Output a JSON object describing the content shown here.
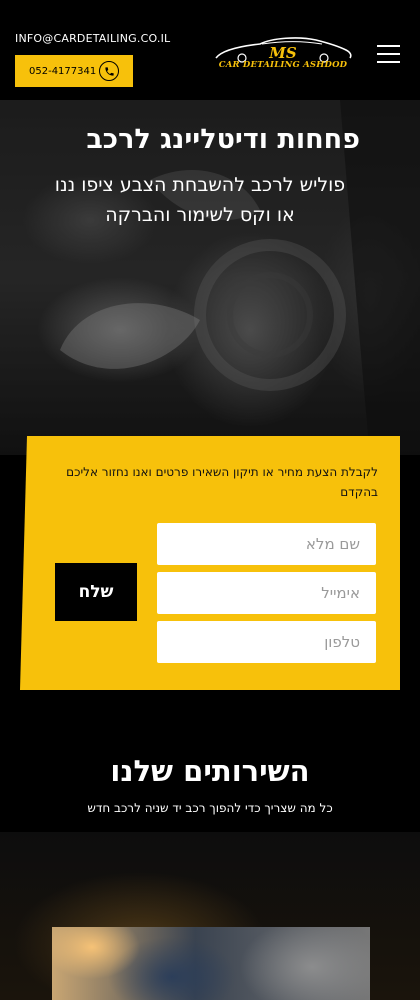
{
  "header": {
    "email": "INFO@CARDETAILING.CO.IL",
    "phone": "052-4177341",
    "logo_initials": "MS",
    "logo_name": "CAR DETAILING ASHDOD"
  },
  "hero": {
    "title": "פחחות ודיטליינג לרכב",
    "subtitle": "פוליש לרכב להשבחת הצבע ציפו ננו או וקס לשימור והברקה"
  },
  "form": {
    "note": "לקבלת הצעת מחיר או תיקון השאירו פרטים ואנו נחזור אליכם בהקדם",
    "name_placeholder": "שם מלא",
    "email_placeholder": "אימייל",
    "phone_placeholder": "טלפון",
    "submit_label": "שלח"
  },
  "services": {
    "title": "השירותים שלנו",
    "subtitle": "כל מה שצריך כדי להפוך רכב יד שניה לרכב חדש"
  },
  "colors": {
    "accent": "#f7c10b",
    "background": "#000000"
  }
}
